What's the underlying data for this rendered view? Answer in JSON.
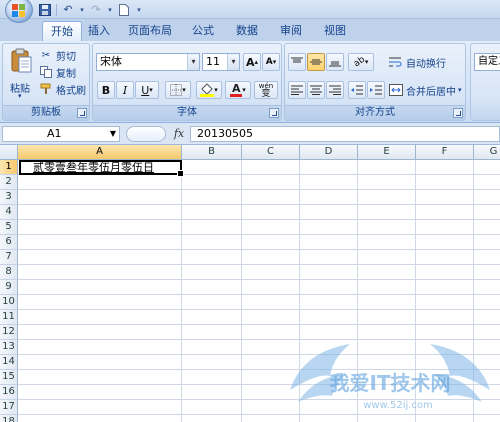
{
  "qat": {
    "save_icon": "save-icon",
    "undo_icon": "undo-icon",
    "redo_icon": "redo-icon",
    "new_icon": "new-document-icon"
  },
  "tabs": [
    {
      "label": "开始",
      "active": true
    },
    {
      "label": "插入"
    },
    {
      "label": "页面布局"
    },
    {
      "label": "公式"
    },
    {
      "label": "数据"
    },
    {
      "label": "审阅"
    },
    {
      "label": "视图"
    }
  ],
  "clipboard": {
    "paste_label": "粘贴",
    "cut_label": "剪切",
    "copy_label": "复制",
    "format_painter_label": "格式刷",
    "group_label": "剪贴板"
  },
  "font": {
    "name_value": "宋体",
    "size_value": "11",
    "bold": "B",
    "italic": "I",
    "underline": "U",
    "phonetic": "wén",
    "phonetic_char": "变",
    "grow": "A",
    "shrink": "A",
    "group_label": "字体"
  },
  "alignment": {
    "wrap_text_label": "自动换行",
    "merge_center_label": "合并后居中",
    "group_label": "对齐方式"
  },
  "number": {
    "format_value": "自定义"
  },
  "formula_bar": {
    "name_box": "A1",
    "fx": "fx",
    "formula": "20130505"
  },
  "sheet": {
    "columns": [
      "A",
      "B",
      "C",
      "D",
      "E",
      "F",
      "G"
    ],
    "rows": [
      "1",
      "2",
      "3",
      "4",
      "5",
      "6",
      "7",
      "8",
      "9",
      "10",
      "11",
      "12",
      "13",
      "14",
      "15",
      "16",
      "17",
      "18"
    ],
    "selected_cell": "A1",
    "cell_a1_display": "贰零壹叁年零伍月零伍日"
  },
  "watermark": {
    "text": "我爱IT技术网",
    "url": "www.52ij.com"
  }
}
